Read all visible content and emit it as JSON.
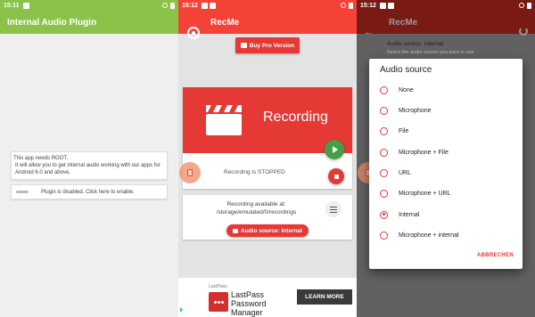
{
  "screens": {
    "plugin": {
      "status_time": "15:11",
      "title": "Internal Audio Plugin",
      "info_lines": [
        "This app needs ROOT.",
        "It will allow you to get internal audio working with our apps for Android 6.0 and above."
      ],
      "toggle_label": "Plugin is disabled. Click here to enable.",
      "accent_color": "#8bc34a"
    },
    "recme": {
      "status_time": "15:12",
      "title": "RecMe",
      "pro_button": "Buy Pro Version",
      "recording_title": "Recording",
      "recording_status": "Recording is STOPPED",
      "available_lines": [
        "Recording available at:",
        "/storage/emulated/0/recordings"
      ],
      "audio_source_button": "Audio source: Internal",
      "accent_color": "#f44336",
      "icons": [
        "clapperboard-icon",
        "play-icon",
        "stop-icon",
        "settings-icon",
        "speaker-icon",
        "cart-icon"
      ]
    },
    "ad": {
      "brand": "LastPass",
      "title": "LastPass Password Manager",
      "button": "LEARN MORE"
    },
    "dialog_screen": {
      "status_time": "15:12",
      "title": "RecMe",
      "background_label": "Audio source: Internal",
      "background_hint": "Select the audio source you want to use",
      "dialog_title": "Audio source",
      "options": [
        {
          "label": "None",
          "selected": false
        },
        {
          "label": "Microphone",
          "selected": false
        },
        {
          "label": "File",
          "selected": false
        },
        {
          "label": "Microphone + File",
          "selected": false
        },
        {
          "label": "URL",
          "selected": false
        },
        {
          "label": "Microphone + URL",
          "selected": false
        },
        {
          "label": "Internal",
          "selected": true
        },
        {
          "label": "Microphone + internal",
          "selected": false
        }
      ],
      "cancel_label": "ABBRECHEN"
    }
  }
}
